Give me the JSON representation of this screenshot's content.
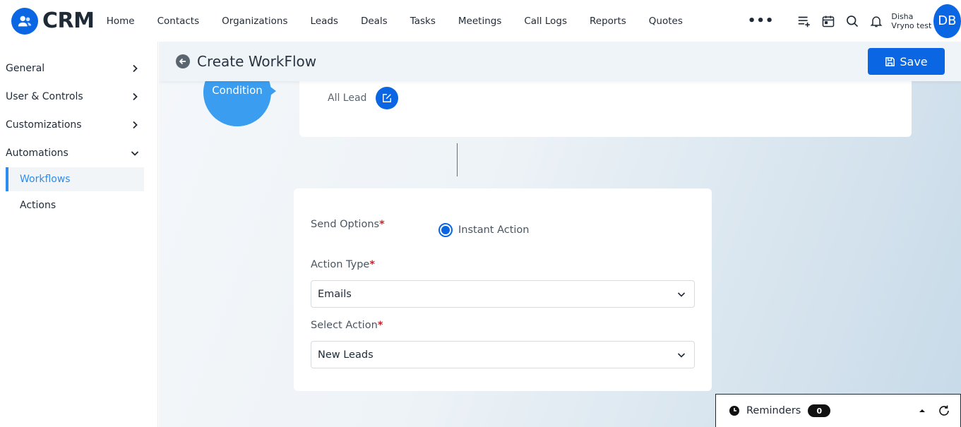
{
  "app": {
    "logo_text": "CRM"
  },
  "nav": {
    "items": [
      "Home",
      "Contacts",
      "Organizations",
      "Leads",
      "Deals",
      "Tasks",
      "Meetings",
      "Call Logs",
      "Reports",
      "Quotes"
    ],
    "more": "•••"
  },
  "user": {
    "first_line": "Disha",
    "second_line": "Vryno test",
    "initials": "DB"
  },
  "sidebar": {
    "sections": [
      "General",
      "User & Controls",
      "Customizations",
      "Automations"
    ],
    "sub_items": [
      "Workflows",
      "Actions"
    ]
  },
  "header": {
    "title": "Create WorkFlow",
    "save_label": "Save"
  },
  "condition": {
    "label": "Condition",
    "text": "All Lead"
  },
  "action_form": {
    "send_options_label": "Send Options",
    "instant_action_label": "Instant Action",
    "action_type_label": "Action Type",
    "action_type_value": "Emails",
    "select_action_label": "Select Action",
    "select_action_value": "New Leads",
    "required_mark": "*"
  },
  "reminders": {
    "label": "Reminders",
    "count": "0"
  },
  "colors": {
    "primary": "#0b66e4",
    "condition": "#3a9df0",
    "active_link": "#2d8cf0",
    "required": "#c0262d"
  }
}
